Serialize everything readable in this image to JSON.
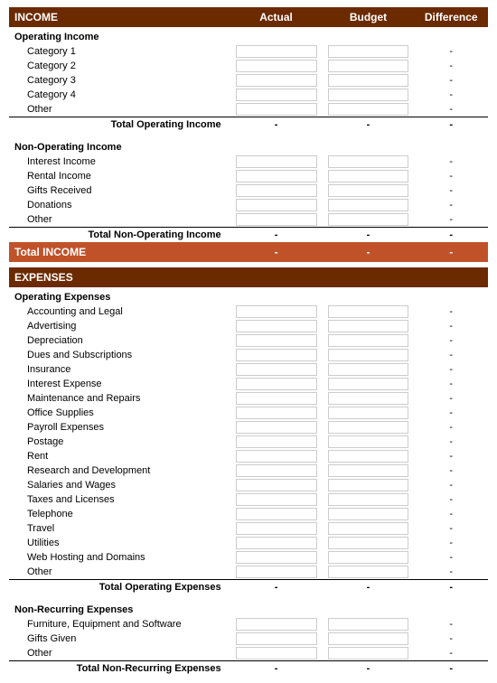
{
  "headers": {
    "income": "INCOME",
    "expenses": "EXPENSES",
    "actual": "Actual",
    "budget": "Budget",
    "difference": "Difference"
  },
  "income": {
    "operating": {
      "label": "Operating Income",
      "items": [
        "Category 1",
        "Category 2",
        "Category 3",
        "Category 4",
        "Other"
      ],
      "total_label": "Total Operating Income",
      "total_actual": "-",
      "total_budget": "-",
      "total_diff": "-"
    },
    "non_operating": {
      "label": "Non-Operating Income",
      "items": [
        "Interest Income",
        "Rental Income",
        "Gifts Received",
        "Donations",
        "Other"
      ],
      "total_label": "Total Non-Operating Income",
      "total_actual": "-",
      "total_budget": "-",
      "total_diff": "-"
    },
    "total": {
      "label": "Total INCOME",
      "actual": "-",
      "budget": "-",
      "diff": "-"
    }
  },
  "expenses": {
    "operating": {
      "label": "Operating Expenses",
      "items": [
        "Accounting and Legal",
        "Advertising",
        "Depreciation",
        "Dues and Subscriptions",
        "Insurance",
        "Interest Expense",
        "Maintenance and Repairs",
        "Office Supplies",
        "Payroll Expenses",
        "Postage",
        "Rent",
        "Research and Development",
        "Salaries and Wages",
        "Taxes and Licenses",
        "Telephone",
        "Travel",
        "Utilities",
        "Web Hosting and Domains",
        "Other"
      ],
      "total_label": "Total Operating Expenses",
      "total_actual": "-",
      "total_budget": "-",
      "total_diff": "-"
    },
    "non_recurring": {
      "label": "Non-Recurring Expenses",
      "items": [
        "Furniture, Equipment and Software",
        "Gifts Given",
        "Other"
      ],
      "total_label": "Total Non-Recurring Expenses",
      "total_actual": "-",
      "total_budget": "-",
      "total_diff": "-"
    }
  }
}
